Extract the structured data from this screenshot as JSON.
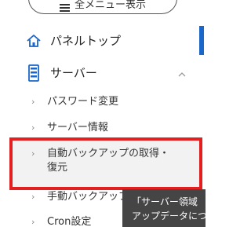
{
  "header": {
    "all_menu_label": "全メニュー表示"
  },
  "nav": {
    "items": [
      {
        "label": "パネルトップ",
        "icon": "home-icon",
        "active": true
      },
      {
        "label": "サーバー",
        "icon": "server-icon",
        "expanded": true
      }
    ],
    "server_submenu": [
      {
        "label": "パスワード変更"
      },
      {
        "label": "サーバー情報"
      },
      {
        "label": "自動バックアップの取得・",
        "label_line2": "復元",
        "highlighted": true
      },
      {
        "label": "手動バックアップ作成"
      },
      {
        "label": "Cron設定"
      }
    ]
  },
  "tooltip": {
    "line1": "「サーバー領域",
    "line2": "アップデータについ"
  },
  "colors": {
    "accent": "#1a66c9",
    "highlight_border": "#e31f1f",
    "tooltip_bg": "#454545"
  }
}
